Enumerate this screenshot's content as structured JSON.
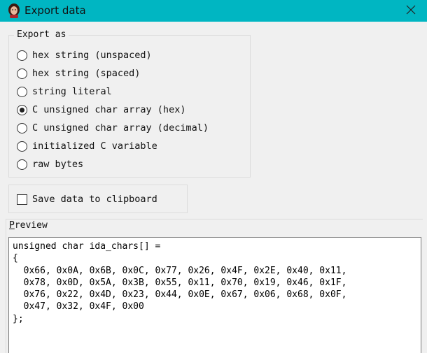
{
  "window": {
    "title": "Export data"
  },
  "export_as": {
    "legend": "Export as",
    "options": [
      {
        "label": "hex string (unspaced)",
        "checked": false
      },
      {
        "label": "hex string (spaced)",
        "checked": false
      },
      {
        "label": "string literal",
        "checked": false
      },
      {
        "label": "C unsigned char array (hex)",
        "checked": true
      },
      {
        "label": "C unsigned char array (decimal)",
        "checked": false
      },
      {
        "label": "initialized C variable",
        "checked": false
      },
      {
        "label": "raw bytes",
        "checked": false
      }
    ]
  },
  "clipboard": {
    "label": "Save data to clipboard",
    "checked": false
  },
  "preview": {
    "label_first": "P",
    "label_rest": "review",
    "lines": [
      "unsigned char ida_chars[] =",
      "{",
      "  0x66, 0x0A, 0x6B, 0x0C, 0x77, 0x26, 0x4F, 0x2E, 0x40, 0x11,",
      "  0x78, 0x0D, 0x5A, 0x3B, 0x55, 0x11, 0x70, 0x19, 0x46, 0x1F,",
      "  0x76, 0x22, 0x4D, 0x23, 0x44, 0x0E, 0x67, 0x06, 0x68, 0x0F,",
      "  0x47, 0x32, 0x4F, 0x00",
      "};"
    ]
  },
  "colors": {
    "titlebar": "#00b6c2",
    "background": "#f0f0f0"
  },
  "icons": {
    "app": "avatar-icon",
    "close": "close-icon"
  }
}
